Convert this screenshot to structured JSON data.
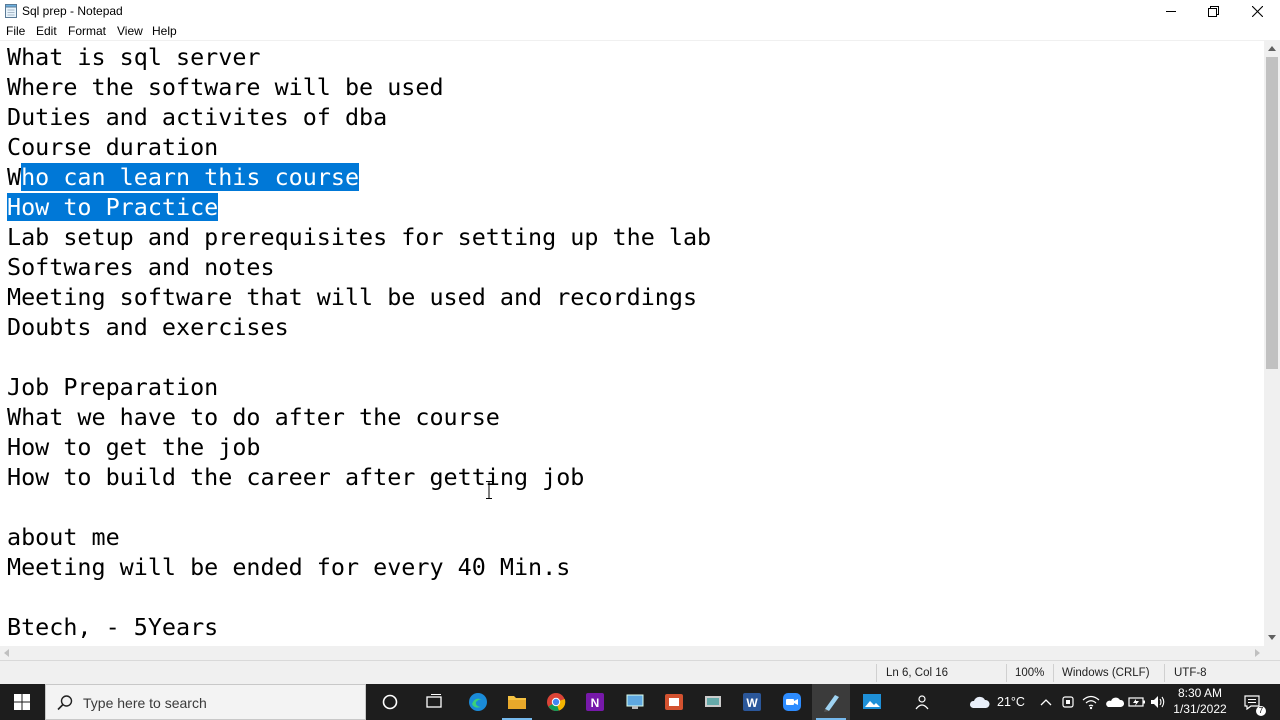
{
  "window": {
    "title": "Sql prep - Notepad"
  },
  "menu": [
    "File",
    "Edit",
    "Format",
    "View",
    "Help"
  ],
  "editor": {
    "lines": [
      {
        "text": "What is sql server"
      },
      {
        "text": "Where the software will be used"
      },
      {
        "text": "Duties and activites of dba"
      },
      {
        "text": "Course duration"
      },
      {
        "pre": "W",
        "sel": "ho can learn this course",
        "post": ""
      },
      {
        "pre": "",
        "sel": "How to Practice",
        "post": ""
      },
      {
        "text": "Lab setup and prerequisites for setting up the lab"
      },
      {
        "text": "Softwares and notes"
      },
      {
        "text": "Meeting software that will be used and recordings"
      },
      {
        "text": "Doubts and exercises"
      },
      {
        "text": ""
      },
      {
        "text": "Job Preparation"
      },
      {
        "text": "What we have to do after the course"
      },
      {
        "text": "How to get the job"
      },
      {
        "text": "How to build the career after getting job"
      },
      {
        "text": ""
      },
      {
        "text": "about me"
      },
      {
        "text": "Meeting will be ended for every 40 Min.s"
      },
      {
        "text": ""
      },
      {
        "text": "Btech, - 5Years"
      }
    ]
  },
  "statusbar": {
    "position": "Ln 6, Col 16",
    "zoom": "100%",
    "line_ending": "Windows (CRLF)",
    "encoding": "UTF-8"
  },
  "taskbar": {
    "search_placeholder": "Type here to search",
    "temperature": "21°C",
    "time": "8:30 AM",
    "date": "1/31/2022",
    "notification_count": "7"
  },
  "colors": {
    "selection": "#0078d7",
    "taskbar": "#1d1d1d"
  }
}
